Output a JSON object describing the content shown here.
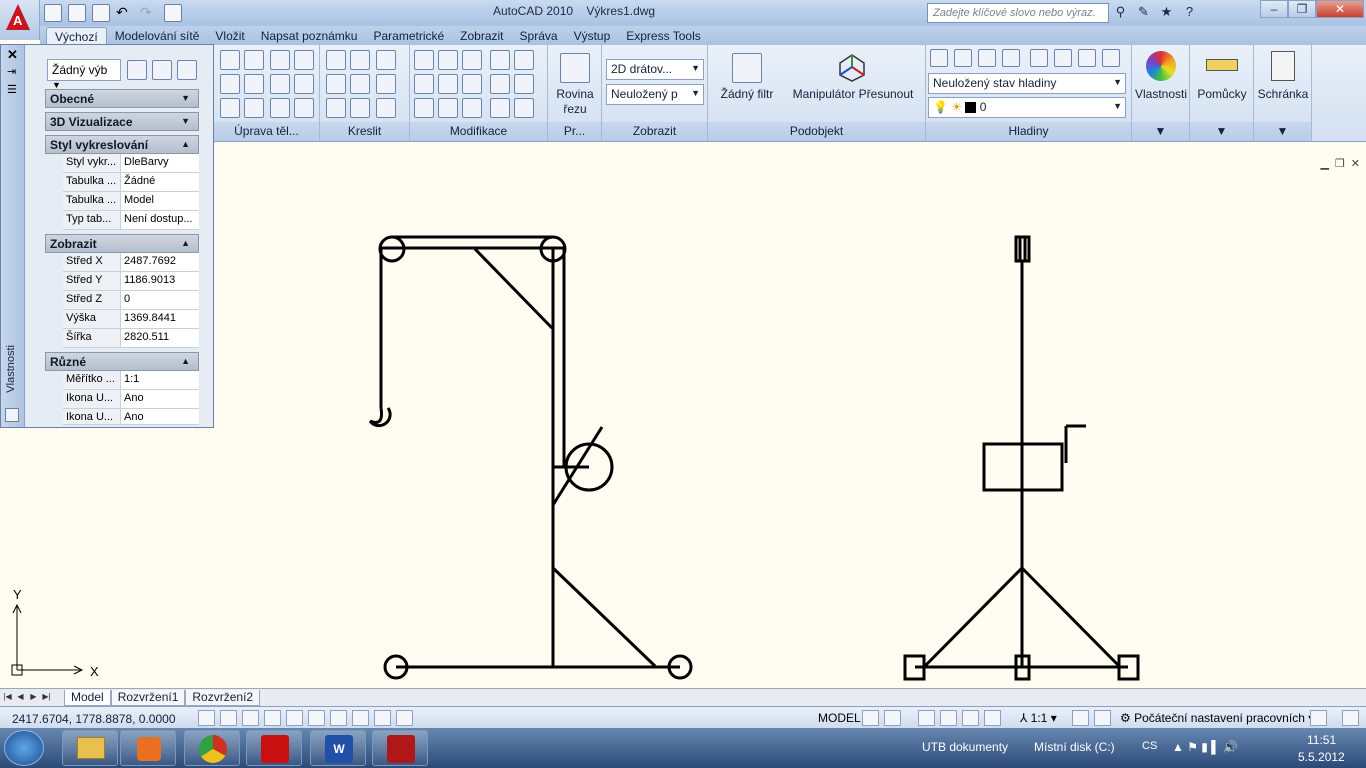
{
  "app": {
    "title": "AutoCAD 2010",
    "document": "Výkres1.dwg",
    "search_placeholder": "Zadejte klíčové slovo nebo výraz."
  },
  "tabs": [
    "Výchozí",
    "Modelování sítě",
    "Vložit",
    "Napsat poznámku",
    "Parametrické",
    "Zobrazit",
    "Správa",
    "Výstup",
    "Express Tools"
  ],
  "ribbon": {
    "panels": [
      "Úprava těl...",
      "Kreslit",
      "Modifikace",
      "Pr...",
      "Zobrazit",
      "Podobjekt",
      "Hladiny"
    ],
    "rovina_label1": "Rovina",
    "rovina_label2": "řezu",
    "visual_style": "2D drátov...",
    "saved_view": "Neuložený p",
    "filter_label": "Žádný filtr",
    "gizmo_label": "Manipulátor Přesunout",
    "layer_state": "Neuložený stav hladiny",
    "layer_current": "0",
    "props_label": "Vlastnosti",
    "utils_label": "Pomůcky",
    "clipboard_label": "Schránka"
  },
  "palette": {
    "title": "Vlastnosti",
    "selection": "Žádný výb",
    "sections": {
      "general": "Obecné",
      "viz3d": "3D Vizualizace",
      "plotstyle": "Styl vykreslování",
      "view": "Zobrazit",
      "misc": "Různé"
    },
    "plot_rows": [
      {
        "k": "Styl vykr...",
        "v": "DleBarvy"
      },
      {
        "k": "Tabulka ...",
        "v": "Žádné"
      },
      {
        "k": "Tabulka ...",
        "v": "Model"
      },
      {
        "k": "Typ tab...",
        "v": "Není dostup..."
      }
    ],
    "view_rows": [
      {
        "k": "Střed X",
        "v": "2487.7692"
      },
      {
        "k": "Střed Y",
        "v": "1186.9013"
      },
      {
        "k": "Střed Z",
        "v": "0"
      },
      {
        "k": "Výška",
        "v": "1369.8441"
      },
      {
        "k": "Šířka",
        "v": "2820.511"
      }
    ],
    "misc_rows": [
      {
        "k": "Měřítko ...",
        "v": "1:1"
      },
      {
        "k": "Ikona U...",
        "v": "Ano"
      },
      {
        "k": "Ikona U...",
        "v": "Ano"
      }
    ]
  },
  "ucs": {
    "x": "X",
    "y": "Y"
  },
  "layout_tabs": [
    "Model",
    "Rozvržení1",
    "Rozvržení2"
  ],
  "status": {
    "coords": "2417.6704, 1778.8878, 0.0000",
    "model": "MODEL",
    "scale": "1:1",
    "workspace": "Počáteční nastavení pracovních"
  },
  "taskbar": {
    "toolbar1": "UTB dokumenty",
    "toolbar2": "Místní disk (C:)",
    "lang": "CS",
    "time": "11:51",
    "date": "5.5.2012"
  }
}
